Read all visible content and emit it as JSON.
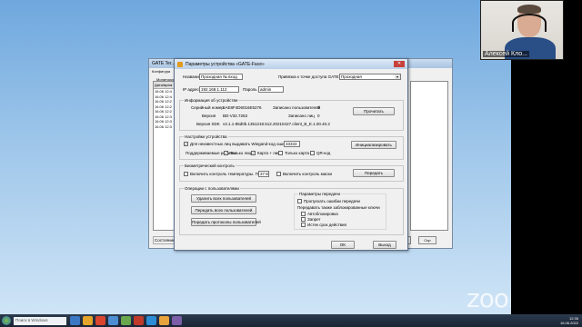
{
  "desktop": {
    "labels": [
      "",
      ""
    ]
  },
  "background_window": {
    "title": "GATE Ter...",
    "menu": "Конфигура",
    "list_header": "Дата/врем",
    "list_rows": [
      "16.06 12:4",
      "16.06 12:4",
      "16.06 12:2",
      "16.06 12:2",
      "16.06 12:2",
      "16.06 12:3",
      "16.06 12:3",
      "16.06 12:3"
    ],
    "tab_label": "Мониторинг",
    "status": "Состояние с",
    "right_buttons": [
      "Отм",
      "Спр"
    ]
  },
  "dialog": {
    "title": "Параметры устройства «GATE-Face»",
    "close_glyph": "✕",
    "name_label": "Название",
    "name_value": "Проходная № вход",
    "access_point_label": "Привязка к точке доступа GATE:",
    "access_point_value": "Проходная",
    "ip_label": "IP адрес",
    "ip_value": "192.168.1.112",
    "password_label": "Пароль",
    "password_value": "admin",
    "info_group": "Информация об устройстве",
    "serial_label": "Серийный номер",
    "serial_value": "6AE8F4D6016E5276",
    "records_users_label": "Записано пользователей",
    "records_users_value": "0",
    "version_label": "Версия",
    "version_value": "BD-V32.7263",
    "records_faces_label": "Записано лиц",
    "records_faces_value": "0",
    "sdk_label": "Версия SDK",
    "sdk_value": "v3.1.1-85d0b.1351218.512.20210427.client_B_E.1.00.40.2",
    "read_button": "Прочитать",
    "settings_group": "Настройки устройства",
    "wiegand_check_label": "Для неизвестных лиц выдавать Wiegand-код ошибки",
    "wiegand_value": "33333",
    "init_button": "Инициализировать",
    "mode_label": "Поддерживаемые режимы",
    "modes": [
      "Только лицо",
      "Карта + лицо",
      "Только карта",
      "QR-код"
    ],
    "temp_group": "Биометрический контроль",
    "temp_check_label": "Включить контроль температуры. Порог",
    "temp_value": "37.8",
    "mask_check_label": "Включить контроль маски",
    "send_button": "Передать",
    "users_group": "Операции с пользователями",
    "delete_users_button": "Удалить всех пользователей",
    "send_all_button": "Передать всех пользователей",
    "send_changed_button": "Передать протоколы пользователей",
    "transfer_group": "Параметры передачи",
    "skip_errors_label": "Пропускать ошибки передачи",
    "also_send_label": "Передавать также заблокированные ключи",
    "transfer_opts": [
      "Автоблокировка",
      "Запрет",
      "Истек срок действия"
    ],
    "ok_button": "OK",
    "exit_button": "Выход"
  },
  "webcam": {
    "participant_name": "Алексей Кло..."
  },
  "zoom_watermark": "zoom",
  "taskbar": {
    "search_placeholder": "Поиск в Windows",
    "clock_time": "12:35",
    "clock_date": "16.06.2022"
  }
}
